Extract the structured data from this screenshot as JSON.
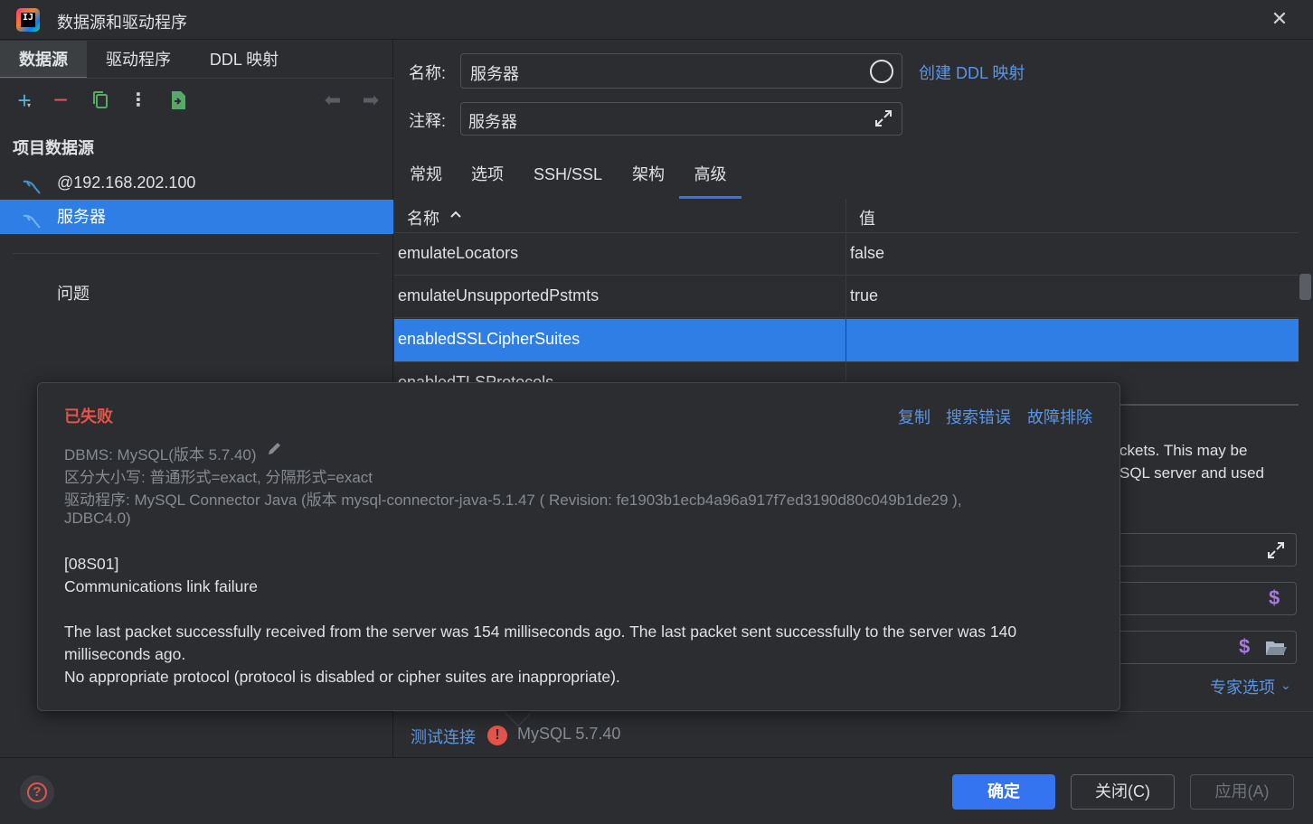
{
  "window": {
    "title": "数据源和驱动程序",
    "close_glyph": "✕"
  },
  "left": {
    "tabs": [
      "数据源",
      "驱动程序",
      "DDL 映射"
    ],
    "section_title": "项目数据源",
    "datasources": [
      "@192.168.202.100",
      "服务器"
    ],
    "problems_label": "问题"
  },
  "form": {
    "name_label": "名称:",
    "name_value": "服务器",
    "create_ddl_link": "创建 DDL 映射",
    "comment_label": "注释:",
    "comment_value": "服务器"
  },
  "tabs": [
    "常规",
    "选项",
    "SSH/SSL",
    "架构",
    "高级"
  ],
  "table": {
    "columns": [
      "名称",
      "值"
    ],
    "rows": [
      {
        "name": "emulateLocators",
        "value": "false"
      },
      {
        "name": "emulateUnsupportedPstmts",
        "value": "true"
      },
      {
        "name": "enabledSSLCipherSuites",
        "value": ""
      },
      {
        "name": "enabledTLSProtocols",
        "value": ""
      }
    ]
  },
  "partial_description": [
    "ckets. This may be",
    "SQL server and used"
  ],
  "expert_options": "专家选项",
  "status": {
    "test_connection": "测试连接",
    "error_glyph": "!",
    "db_version": "MySQL 5.7.40"
  },
  "error_popup": {
    "title": "已失败",
    "links": [
      "复制",
      "搜索错误",
      "故障排除"
    ],
    "dbms": "DBMS: MySQL(版本 5.7.40)",
    "case_sensitivity": "区分大小写: 普通形式=exact, 分隔形式=exact",
    "driver": "驱动程序: MySQL Connector Java (版本 mysql-connector-java-5.1.47 ( Revision: fe1903b1ecb4a96a917f7ed3190d80c049b1de29 ),",
    "jdbc": "JDBC4.0)",
    "error_code": "[08S01]",
    "error_title": "Communications link failure",
    "message_line1": "The last packet successfully received from the server was 154 milliseconds ago. The last packet sent successfully to the server was 140",
    "message_line2": "milliseconds ago.",
    "message_line3": "No appropriate protocol (protocol is disabled or cipher suites are inappropriate)."
  },
  "buttons": {
    "ok": "确定",
    "close": "关闭(C)",
    "apply": "应用(A)"
  },
  "colors": {
    "accent": "#3574f0",
    "selection": "#2e7ee6",
    "error": "#e5544b",
    "link": "#5b95e6"
  }
}
